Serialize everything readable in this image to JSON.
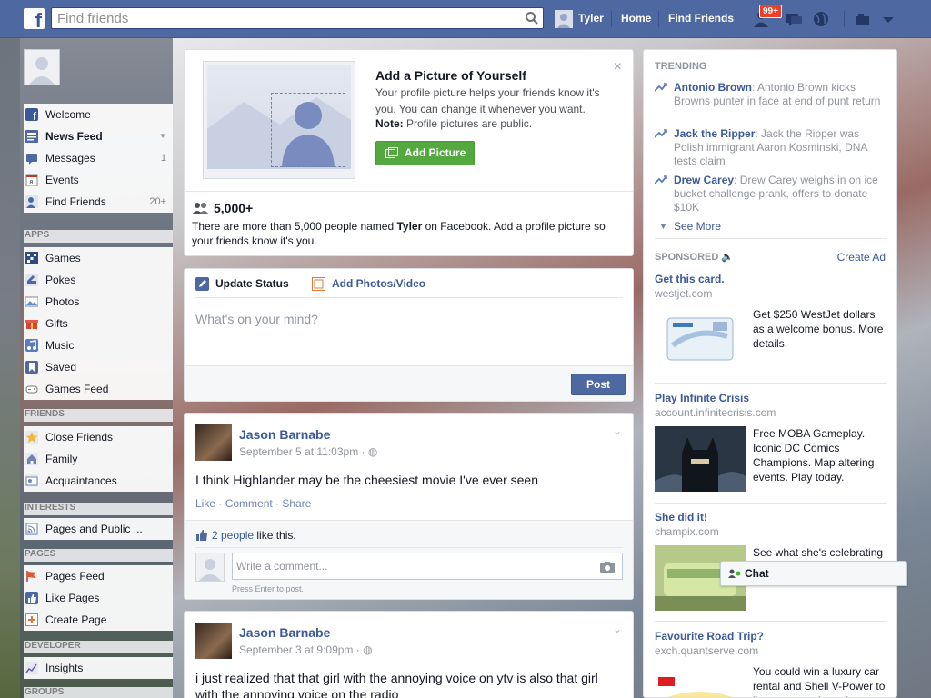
{
  "topbar": {
    "logo": "f",
    "search_placeholder": "Find friends",
    "user_name": "Tyler",
    "home": "Home",
    "find_friends": "Find Friends",
    "notifications_count": "99+",
    "colors": {
      "bar": "#4e69a2",
      "badge": "#f03d25"
    }
  },
  "sidebar": {
    "main": [
      {
        "label": "Welcome",
        "icon": "facebook-icon",
        "count": ""
      },
      {
        "label": "News Feed",
        "icon": "news-feed-icon",
        "count": ""
      },
      {
        "label": "Messages",
        "icon": "messages-icon",
        "count": "1"
      },
      {
        "label": "Events",
        "icon": "calendar-icon",
        "count": ""
      },
      {
        "label": "Find Friends",
        "icon": "find-friends-icon",
        "count": "20+"
      }
    ],
    "apps_head": "APPS",
    "apps": [
      {
        "label": "Games",
        "icon": "games-icon"
      },
      {
        "label": "Pokes",
        "icon": "pokes-icon"
      },
      {
        "label": "Photos",
        "icon": "photos-icon"
      },
      {
        "label": "Gifts",
        "icon": "gift-icon"
      },
      {
        "label": "Music",
        "icon": "music-icon"
      },
      {
        "label": "Saved",
        "icon": "bookmark-icon"
      },
      {
        "label": "Games Feed",
        "icon": "controller-icon"
      }
    ],
    "friends_head": "FRIENDS",
    "friends": [
      {
        "label": "Close Friends",
        "icon": "star-icon"
      },
      {
        "label": "Family",
        "icon": "family-icon"
      },
      {
        "label": "Acquaintances",
        "icon": "acquaintances-icon"
      }
    ],
    "interests_head": "INTERESTS",
    "interests": [
      {
        "label": "Pages and Public ...",
        "icon": "rss-icon"
      }
    ],
    "pages_head": "PAGES",
    "pages": [
      {
        "label": "Pages Feed",
        "icon": "flag-icon"
      },
      {
        "label": "Like Pages",
        "icon": "thumbs-up-icon"
      },
      {
        "label": "Create Page",
        "icon": "plus-icon"
      }
    ],
    "developer_head": "DEVELOPER",
    "developer": [
      {
        "label": "Insights",
        "icon": "chart-icon"
      }
    ],
    "groups_head": "GROUPS"
  },
  "add_picture": {
    "title": "Add a Picture of Yourself",
    "text": "Your profile picture helps your friends know it's you. You can change it whenever you want.",
    "note_label": "Note:",
    "note_text": " Profile pictures are public.",
    "button": "Add Picture",
    "close": "×",
    "people_count": "5,000+",
    "people_text_1": "There are more than 5,000 people named ",
    "people_name": "Tyler",
    "people_text_2": " on Facebook. Add a profile picture so your friends know it's you."
  },
  "status": {
    "tab_update": "Update Status",
    "tab_photos": "Add Photos/Video",
    "placeholder": "What's on your mind?",
    "post_button": "Post"
  },
  "posts": [
    {
      "author": "Jason Barnabe",
      "date": "September 5 at 11:03pm",
      "text": "I think Highlander may be the cheesiest movie I've ever seen",
      "like": "Like",
      "comment": "Comment",
      "share": "Share",
      "likes_link": "2 people",
      "likes_suffix": " like this.",
      "comment_placeholder": "Write a comment...",
      "comment_hint": "Press Enter to post."
    },
    {
      "author": "Jason Barnabe",
      "date": "September 3 at 9:09pm",
      "text": "i just realized that that girl with the annoying voice on ytv is also that girl with the annoying voice on the radio"
    }
  ],
  "trending": {
    "head": "TRENDING",
    "items": [
      {
        "name": "Antonio Brown",
        "desc": ": Antonio Brown kicks Browns punter in face at end of punt return"
      },
      {
        "name": "Jack the Ripper",
        "desc": ": Jack the Ripper was Polish immigrant Aaron Kosminski, DNA tests claim"
      },
      {
        "name": "Drew Carey",
        "desc": ": Drew Carey weighs in on ice bucket challenge prank, offers to donate $10K"
      }
    ],
    "see_more": "See More"
  },
  "sponsored": {
    "head": "SPONSORED",
    "create_ad": "Create Ad",
    "ads": [
      {
        "title": "Get this card.",
        "url": "westjet.com",
        "text": "Get $250 WestJet dollars as a welcome bonus. More details."
      },
      {
        "title": "Play Infinite Crisis",
        "url": "account.infinitecrisis.com",
        "text": "Free MOBA Gameplay. Iconic DC Comics Champions. Map altering events. Play today."
      },
      {
        "title": "She did it!",
        "url": "champix.com",
        "text": "See what she's celebrating"
      },
      {
        "title": "Favourite Road Trip?",
        "url": "exch.quantserve.com",
        "text": "You could win a luxury car rental and Shell V-Power to live out your dream!"
      }
    ]
  },
  "chat": {
    "label": "Chat"
  }
}
